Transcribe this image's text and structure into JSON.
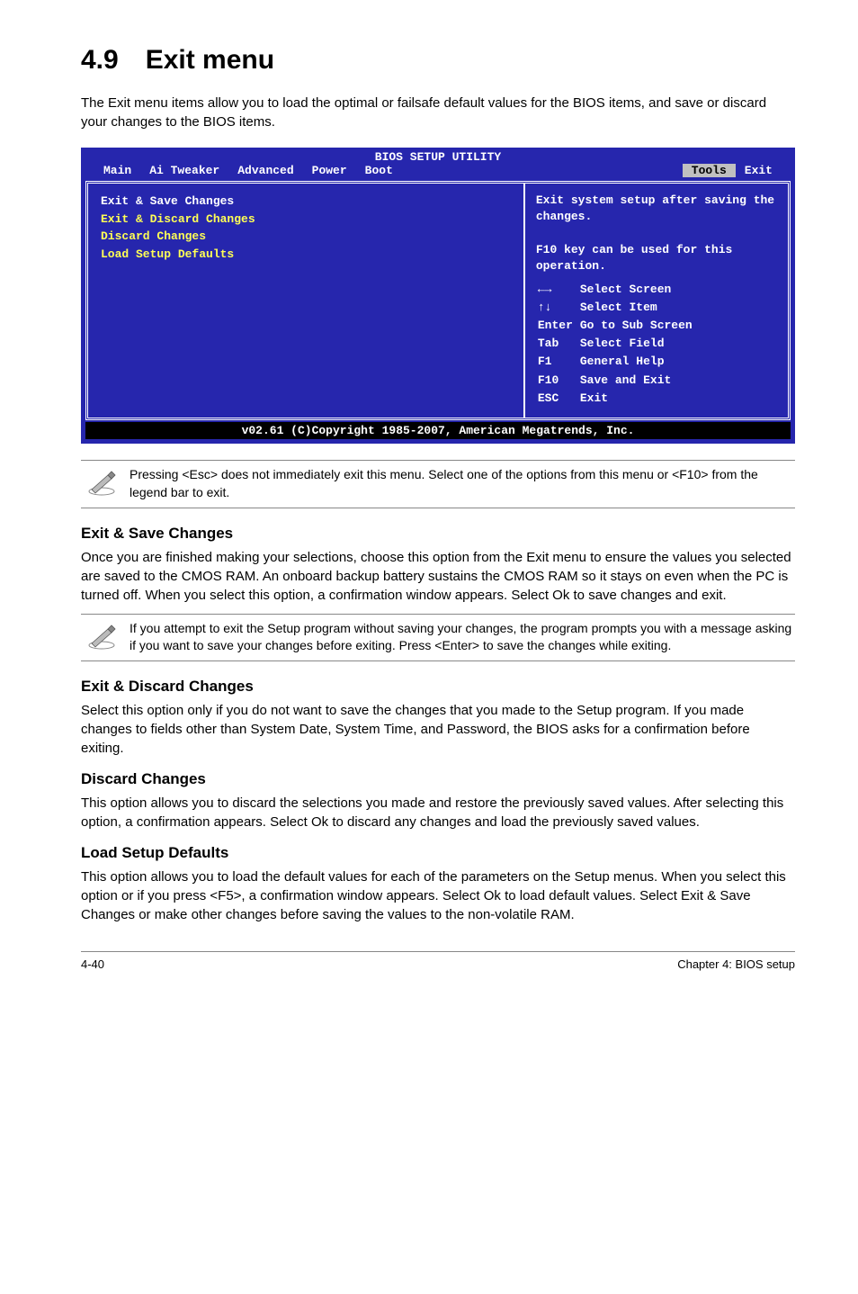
{
  "title": "4.9 Exit menu",
  "intro": "The Exit menu items allow you to load the optimal or failsafe default values for the BIOS items, and save or discard your changes to the BIOS items.",
  "bios": {
    "title": "BIOS SETUP UTILITY",
    "tabs": [
      "Main",
      "Ai Tweaker",
      "Advanced",
      "Power",
      "Boot"
    ],
    "right_tabs": [
      "Tools",
      "Exit"
    ],
    "selected_tab": "Tools",
    "left_items": [
      "Exit & Save Changes",
      "Exit & Discard Changes",
      "Discard Changes",
      "",
      "Load Setup Defaults"
    ],
    "help": [
      "Exit system setup after saving the changes.",
      "",
      "F10 key can be used for this operation."
    ],
    "keys": [
      {
        "key": "←→",
        "label": "Select Screen"
      },
      {
        "key": "↑↓",
        "label": "Select Item"
      },
      {
        "key": "Enter",
        "label": "Go to Sub Screen"
      },
      {
        "key": "Tab",
        "label": "Select Field"
      },
      {
        "key": "F1",
        "label": "General Help"
      },
      {
        "key": "F10",
        "label": "Save and Exit"
      },
      {
        "key": "ESC",
        "label": "Exit"
      }
    ],
    "footer": "v02.61 (C)Copyright 1985-2007, American Megatrends, Inc."
  },
  "note1": "Pressing <Esc> does not immediately exit this menu. Select one of the options from this menu or <F10> from the legend bar to exit.",
  "sections": {
    "s1": {
      "heading": "Exit & Save Changes",
      "text": "Once you are finished making your selections, choose this option from the Exit menu to ensure the values you selected are saved to the CMOS RAM. An onboard backup battery sustains the CMOS RAM so it stays on even when the PC is turned off. When you select this option, a confirmation window appears. Select Ok to save changes and exit."
    },
    "s2": {
      "heading": "Exit & Discard Changes",
      "text": "Select this option only if you do not want to save the changes that you  made to the Setup program. If you made changes to fields other than System Date, System Time, and Password, the BIOS asks for a confirmation before exiting."
    },
    "s3": {
      "heading": "Discard Changes",
      "text": "This option allows you to discard the selections you made and restore the previously saved values. After selecting this option, a confirmation appears. Select Ok to discard any changes and load the previously saved values."
    },
    "s4": {
      "heading": "Load Setup Defaults",
      "text": "This option allows you to load the default values for each of the parameters on the Setup menus. When you select this option or if you press <F5>, a confirmation window appears. Select Ok to load default values. Select Exit & Save Changes or make other changes before saving the values to the non-volatile RAM."
    }
  },
  "note2": "If you attempt to exit the Setup program without saving your changes, the program prompts you with a message asking if you want to save your changes before exiting. Press <Enter> to save the changes while exiting.",
  "footer": {
    "left": "4-40",
    "right": "Chapter 4: BIOS setup"
  }
}
